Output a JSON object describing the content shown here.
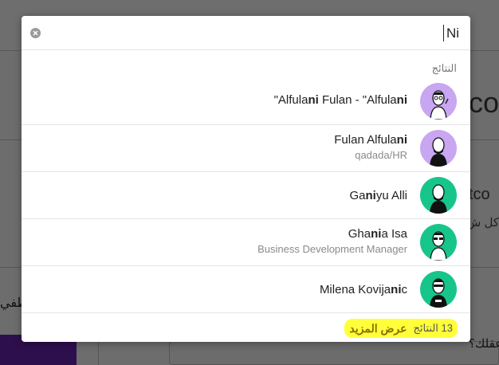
{
  "search": {
    "value": "Ni",
    "placeholder": ""
  },
  "results_label": "النتائج",
  "results": [
    {
      "name_parts": [
        [
          "\"Alful",
          false
        ],
        [
          "a",
          true
        ],
        [
          "ni Fulan - \"Alful",
          false
        ],
        [
          "a",
          true
        ],
        [
          "ni",
          true
        ]
      ],
      "name": "\"Alfulani Fulan - \"Alfulani",
      "subtitle": "",
      "avatar_color": "#c8a6f2",
      "avatar_icon": "person-with-glasses-icon"
    },
    {
      "name": "Fulan Alfulani",
      "subtitle": "qadada/HR",
      "avatar_color": "#c8a6f2",
      "avatar_icon": "person-bald-icon"
    },
    {
      "name": "Ganiyu Alli",
      "subtitle": "",
      "avatar_color": "#17c58a",
      "avatar_icon": "person-bald-icon"
    },
    {
      "name": "Ghania Isa",
      "subtitle": "Business Development Manager",
      "avatar_color": "#17c58a",
      "avatar_icon": "person-with-glasses-icon"
    },
    {
      "name": "Milena Kovijanic",
      "subtitle": "",
      "avatar_color": "#17c58a",
      "avatar_icon": "person-with-sunglasses-icon"
    }
  ],
  "footer": {
    "count_text": "13 النتائج",
    "see_more_label": "عرض المزيد"
  },
  "background": {
    "heading_fragment": "co",
    "subheading_fragment": "tco",
    "text_fragment": "كل ش",
    "left_fragment": "ظفي",
    "bottom_fragment": "عقلك؟"
  }
}
